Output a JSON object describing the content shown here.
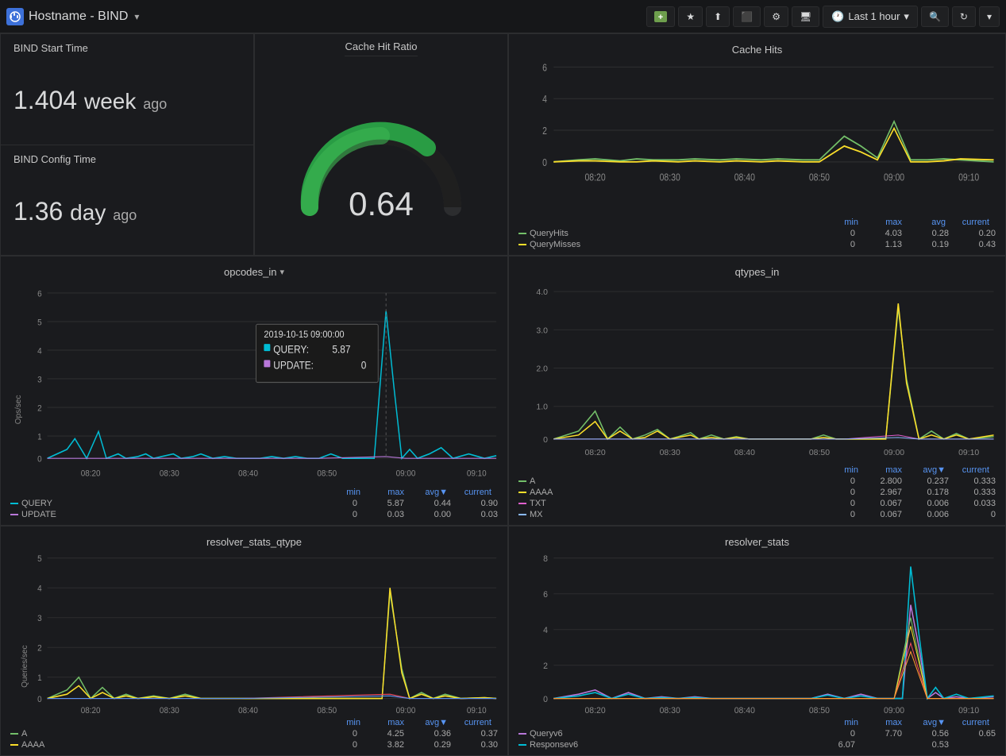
{
  "topnav": {
    "logo_text": "⊞",
    "title": "Hostname - BIND",
    "title_suffix": "▾",
    "buttons": [
      "add-panel",
      "star",
      "share",
      "library",
      "settings",
      "display"
    ],
    "time_label": "Last 1 hour",
    "search_icon": "🔍",
    "refresh_icon": "↻",
    "more_icon": "▾"
  },
  "panels": {
    "bind_start": {
      "title": "BIND Start Time",
      "value": "1.404",
      "unit": "week",
      "suffix": "ago"
    },
    "bind_config": {
      "title": "BIND Config Time",
      "value": "1.36",
      "unit": "day",
      "suffix": "ago"
    },
    "cache_hit_ratio": {
      "title": "Cache Hit Ratio",
      "value": "0.64"
    },
    "cache_hits": {
      "title": "Cache Hits",
      "y_labels": [
        "6",
        "4",
        "2",
        "0"
      ],
      "x_labels": [
        "08:20",
        "08:30",
        "08:40",
        "08:50",
        "09:00",
        "09:10"
      ],
      "legend_headers": [
        "min",
        "max",
        "avg",
        "current"
      ],
      "legend": [
        {
          "label": "QueryHits",
          "color": "#73bf69",
          "min": "0",
          "max": "4.03",
          "avg": "0.28",
          "current": "0.20"
        },
        {
          "label": "QueryMisses",
          "color": "#fade2a",
          "min": "0",
          "max": "1.13",
          "avg": "0.19",
          "current": "0.43"
        }
      ]
    },
    "opcodes_in": {
      "title": "opcodes_in",
      "y_labels": [
        "6",
        "5",
        "4",
        "3",
        "2",
        "1",
        "0"
      ],
      "x_labels": [
        "08:20",
        "08:30",
        "08:40",
        "08:50",
        "09:00",
        "09:10"
      ],
      "y_axis_label": "Ops/sec",
      "tooltip": {
        "time": "2019-10-15 09:00:00",
        "rows": [
          {
            "label": "QUERY",
            "value": "5.87",
            "color": "#00bcd4"
          },
          {
            "label": "UPDATE",
            "value": "0",
            "color": "#b877d9"
          }
        ]
      },
      "legend_headers": [
        "min",
        "max",
        "avg▼",
        "current"
      ],
      "legend": [
        {
          "label": "QUERY",
          "color": "#00bcd4",
          "min": "0",
          "max": "5.87",
          "avg": "0.44",
          "current": "0.90"
        },
        {
          "label": "UPDATE",
          "color": "#b877d9",
          "min": "0",
          "max": "0.03",
          "avg": "0.00",
          "current": "0.03"
        }
      ]
    },
    "qtypes_in": {
      "title": "qtypes_in",
      "y_labels": [
        "4.0",
        "3.0",
        "2.0",
        "1.0",
        "0"
      ],
      "x_labels": [
        "08:20",
        "08:30",
        "08:40",
        "08:50",
        "09:00",
        "09:10"
      ],
      "legend_headers": [
        "min",
        "max",
        "avg▼",
        "current"
      ],
      "legend": [
        {
          "label": "A",
          "color": "#73bf69",
          "min": "0",
          "max": "2.800",
          "avg": "0.237",
          "current": "0.333"
        },
        {
          "label": "AAAA",
          "color": "#fade2a",
          "min": "0",
          "max": "2.967",
          "avg": "0.178",
          "current": "0.333"
        },
        {
          "label": "TXT",
          "color": "#e05fcd",
          "min": "0",
          "max": "0.067",
          "avg": "0.006",
          "current": "0.033"
        },
        {
          "label": "MX",
          "color": "#8ab8ff",
          "min": "0",
          "max": "0.067",
          "avg": "0.006",
          "current": "0"
        }
      ]
    },
    "resolver_stats_qtype": {
      "title": "resolver_stats_qtype",
      "y_labels": [
        "5",
        "4",
        "3",
        "2",
        "1",
        "0"
      ],
      "x_labels": [
        "08:20",
        "08:30",
        "08:40",
        "08:50",
        "09:00",
        "09:10"
      ],
      "y_axis_label": "Queries/sec",
      "legend_headers": [
        "min",
        "max",
        "avg▼",
        "current"
      ],
      "legend": [
        {
          "label": "A",
          "color": "#73bf69",
          "min": "0",
          "max": "4.25",
          "avg": "0.36",
          "current": "0.37"
        },
        {
          "label": "AAAA",
          "color": "#fade2a",
          "min": "0",
          "max": "3.82",
          "avg": "0.29",
          "current": "0.30"
        }
      ]
    },
    "resolver_stats": {
      "title": "resolver_stats",
      "y_labels": [
        "8",
        "6",
        "4",
        "2",
        "0"
      ],
      "x_labels": [
        "08:20",
        "08:30",
        "08:40",
        "08:50",
        "09:00",
        "09:10"
      ],
      "legend_headers": [
        "min",
        "max",
        "avg▼",
        "current"
      ],
      "legend": [
        {
          "label": "Queryv6",
          "color": "#b877d9",
          "min": "0",
          "max": "7.70",
          "avg": "0.56",
          "current": "0.65"
        },
        {
          "label": "Responsev6",
          "color": "#00bcd4",
          "min": "6.07",
          "max": "",
          "avg": "0.53",
          "current": ""
        }
      ]
    }
  }
}
